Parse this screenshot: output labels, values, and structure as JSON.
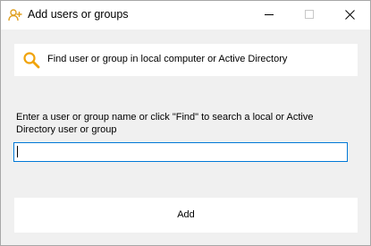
{
  "window": {
    "title": "Add users or groups",
    "title_icon": "add-user-icon",
    "controls": {
      "minimize": "minimize-icon",
      "maximize": "maximize-icon",
      "close": "close-icon"
    }
  },
  "find": {
    "icon": "search-icon",
    "label": "Find user or group in local computer or Active Directory"
  },
  "instruction": "Enter a user or group name or click \"Find\" to search a local or Active Directory user or group",
  "name_input": {
    "value": "",
    "placeholder": ""
  },
  "add_button": {
    "label": "Add"
  },
  "colors": {
    "accent": "#0078d7",
    "icon_orange": "#f0a30a",
    "background": "#f0f0f0",
    "panel": "#ffffff"
  }
}
